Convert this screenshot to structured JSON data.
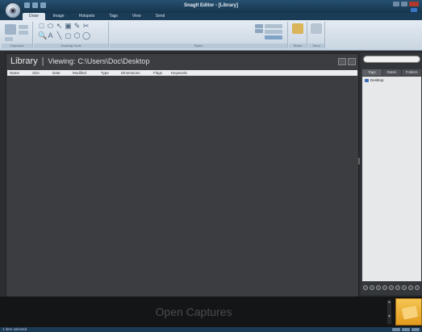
{
  "window": {
    "title": "SnagIt Editor - [Library]"
  },
  "ribbon": {
    "tabs": [
      {
        "label": "Draw",
        "active": true
      },
      {
        "label": "Image",
        "active": false
      },
      {
        "label": "Hotspots",
        "active": false
      },
      {
        "label": "Tags",
        "active": false
      },
      {
        "label": "View",
        "active": false
      },
      {
        "label": "Send",
        "active": false
      }
    ],
    "groups": [
      "Clipboard",
      "Drawing Tools",
      "Styles",
      "Share",
      "Send"
    ],
    "tool_glyphs": [
      "□",
      "⬭",
      "↖",
      "▣",
      "✎",
      "✂",
      "🔍",
      "A",
      "╲",
      "◻",
      "⬡",
      "◯"
    ],
    "icons": [
      "select-icon",
      "callout-icon",
      "arrow-icon",
      "stamp-icon",
      "pen-icon",
      "crop-icon",
      "magnify-icon",
      "text-icon",
      "line-icon",
      "shape-icon",
      "fill-icon",
      "eraser-icon"
    ]
  },
  "library": {
    "title": "Library",
    "separator": "|",
    "viewing_label": "Viewing:",
    "viewing_path": "C:\\Users\\Doc\\Desktop",
    "columns": [
      "Name",
      "Size",
      "Date",
      "Modified",
      "Type",
      "Dimensions",
      "Flags",
      "Keywords"
    ]
  },
  "right_panel": {
    "search_placeholder": "",
    "tabs": [
      {
        "label": "Tags",
        "active": true
      },
      {
        "label": "Dates",
        "active": false
      },
      {
        "label": "Folders",
        "active": false
      }
    ],
    "items": [
      {
        "label": "Desktop",
        "icon": "folder-icon"
      }
    ]
  },
  "tray": {
    "label": "Open Captures"
  },
  "statusbar": {
    "text": "1 item selected"
  },
  "colors": {
    "titlebar": "#1b3c56",
    "ribbon": "#dde6ef",
    "canvas": "#3b3d41",
    "tray": "#141516",
    "thumb_accent": "#e9a82a"
  }
}
